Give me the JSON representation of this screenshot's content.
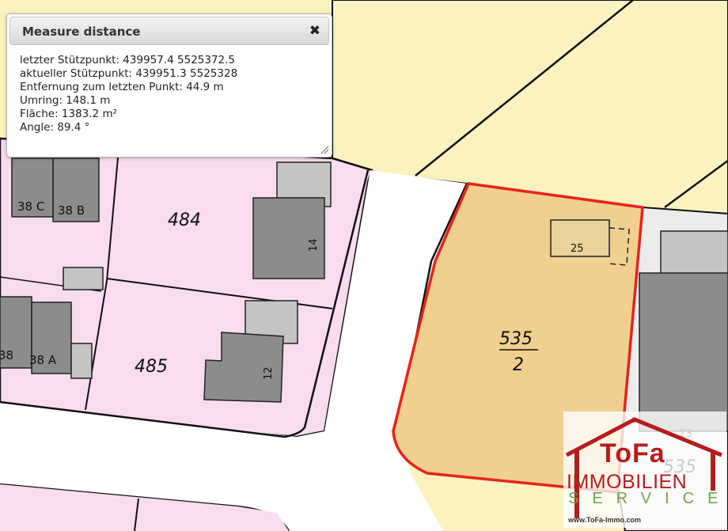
{
  "popup": {
    "title": "Measure distance",
    "close_symbol": "✖",
    "last_vertex": "letzter Stützpunkt: 439957.4 5525372.5",
    "current_vertex": "aktueller Stützpunkt: 439951.3 5525328",
    "distance": "Entfernung zum letzten Punkt: 44.9 m",
    "perimeter": "Umring: 148.1 m",
    "area": "Fläche: 1383.2 m²",
    "angle": "Angle: 89.4 °"
  },
  "map": {
    "parcels": {
      "p484": "484",
      "p485": "485",
      "p535_num": "535",
      "p535_den": "2",
      "p535_right": "535"
    },
    "houses": {
      "h38c": "38 C",
      "h38b": "38 B",
      "h38": "38",
      "h38a": "38 A",
      "h14": "14",
      "h12": "12",
      "h25": "25",
      "h23": "23"
    },
    "colors": {
      "residential_pink": "#f9dcef",
      "field_yellow": "#fbf3bf",
      "selected_parcel": "#f0cf8f",
      "selection_outline": "#e8231c",
      "building_dark": "#8c8c8c",
      "building_light": "#c4c4c4"
    }
  },
  "logo": {
    "brand": "ToFa",
    "line1": "IMMOBILIEN",
    "line2": "SERVICE",
    "url": "www.ToFa-Immo.com",
    "reg_mark": "®"
  }
}
